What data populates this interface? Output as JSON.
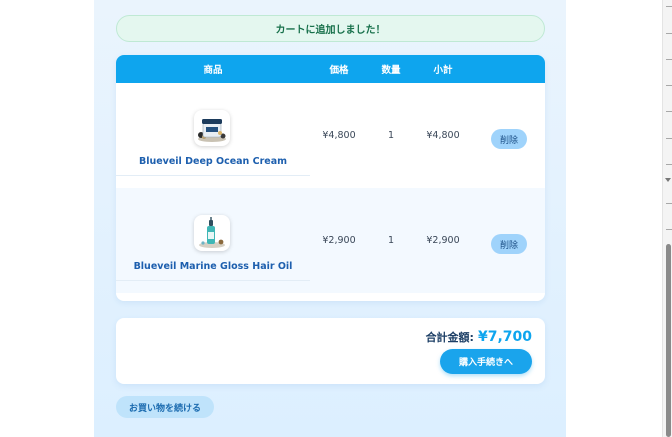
{
  "notice": {
    "text": "カートに追加しました！"
  },
  "table": {
    "headers": {
      "product": "商品",
      "price": "価格",
      "qty": "数量",
      "subtotal": "小計"
    },
    "rows": [
      {
        "name": "Blueveil Deep Ocean Cream",
        "price": "¥4,800",
        "qty": "1",
        "subtotal": "¥4,800",
        "delete_label": "削除",
        "image_icon": "cream-jar-image"
      },
      {
        "name": "Blueveil Marine Gloss Hair Oil",
        "price": "¥2,900",
        "qty": "1",
        "subtotal": "¥2,900",
        "delete_label": "削除",
        "image_icon": "oil-bottle-image"
      }
    ]
  },
  "summary": {
    "total_label": "合計金額:",
    "total_amount": "¥7,700",
    "checkout_label": "購入手続きへ"
  },
  "continue_label": "お買い物を続ける",
  "colors": {
    "accent": "#0ea5ee",
    "notice_bg": "#e4f7ef",
    "notice_text": "#17704a",
    "product_name": "#1d5fae"
  }
}
